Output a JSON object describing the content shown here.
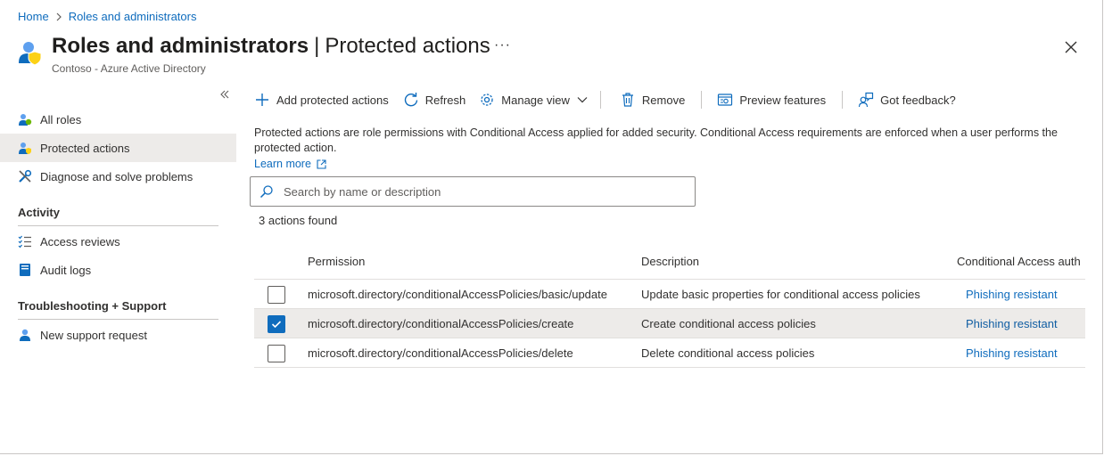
{
  "breadcrumb": {
    "home": "Home",
    "current": "Roles and administrators"
  },
  "header": {
    "title": "Roles and administrators",
    "separator": "|",
    "section": "Protected actions",
    "more": "···",
    "subtitle": "Contoso - Azure Active Directory"
  },
  "sidebar": {
    "items": [
      {
        "label": "All roles"
      },
      {
        "label": "Protected actions"
      },
      {
        "label": "Diagnose and solve problems"
      }
    ],
    "activity_heading": "Activity",
    "activity_items": [
      {
        "label": "Access reviews"
      },
      {
        "label": "Audit logs"
      }
    ],
    "support_heading": "Troubleshooting + Support",
    "support_items": [
      {
        "label": "New support request"
      }
    ]
  },
  "toolbar": {
    "add": "Add protected actions",
    "refresh": "Refresh",
    "manage_view": "Manage view",
    "remove": "Remove",
    "preview": "Preview features",
    "feedback": "Got feedback?"
  },
  "main": {
    "description": "Protected actions are role permissions with Conditional Access applied for added security. Conditional Access requirements are enforced when a user performs the protected action.",
    "learn_more": "Learn more",
    "search_placeholder": "Search by name or description",
    "count": "3 actions found"
  },
  "table": {
    "columns": [
      "Permission",
      "Description",
      "Conditional Access auth"
    ],
    "rows": [
      {
        "permission": "microsoft.directory/conditionalAccessPolicies/basic/update",
        "description": "Update basic properties for conditional access policies",
        "auth": "Phishing resistant",
        "checked": false
      },
      {
        "permission": "microsoft.directory/conditionalAccessPolicies/create",
        "description": "Create conditional access policies",
        "auth": "Phishing resistant",
        "checked": true
      },
      {
        "permission": "microsoft.directory/conditionalAccessPolicies/delete",
        "description": "Delete conditional access policies",
        "auth": "Phishing resistant",
        "checked": false
      }
    ]
  },
  "colors": {
    "accent": "#0f6cbd",
    "selected_row": "#edebe9",
    "text": "#323130"
  }
}
